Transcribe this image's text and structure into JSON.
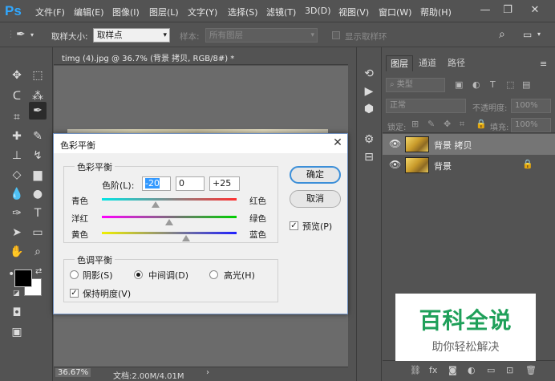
{
  "app": {
    "logo": "Ps",
    "menu": [
      "文件(F)",
      "编辑(E)",
      "图像(I)",
      "图层(L)",
      "文字(Y)",
      "选择(S)",
      "滤镜(T)",
      "3D(D)",
      "视图(V)",
      "窗口(W)",
      "帮助(H)"
    ],
    "window_controls": [
      "minimize-icon",
      "restore-icon",
      "close-icon"
    ]
  },
  "options": {
    "sample_size_label": "取样大小:",
    "sample_size_value": "取样点",
    "sample_label": "样本:",
    "sample_value": "所有图层",
    "show_ring_label": "显示取样环"
  },
  "document": {
    "tab_title": "timg (4).jpg @ 36.7% (背景 拷贝, RGB/8#) *",
    "zoom": "36.67%",
    "doc_info": "文档:2.00M/4.01M"
  },
  "layers_panel": {
    "tabs": [
      "图层",
      "通道",
      "路径"
    ],
    "filter_kind": "类型",
    "blend_mode": "正常",
    "opacity_label": "不透明度:",
    "opacity_value": "100%",
    "lock_label": "锁定:",
    "fill_label": "填充:",
    "fill_value": "100%",
    "layers": [
      {
        "name": "背景 拷贝",
        "selected": true,
        "locked": false
      },
      {
        "name": "背景",
        "selected": false,
        "locked": true
      }
    ]
  },
  "dialog": {
    "title": "色彩平衡",
    "color_balance_group": "色彩平衡",
    "levels_label": "色阶(L):",
    "levels": [
      "-20",
      "0",
      "+25"
    ],
    "sliders": [
      {
        "left": "青色",
        "right": "红色",
        "value": -20,
        "colors": [
          "#00e5e5",
          "#ff3030"
        ]
      },
      {
        "left": "洋红",
        "right": "绿色",
        "value": 0,
        "colors": [
          "#ff00ff",
          "#00d000"
        ]
      },
      {
        "left": "黄色",
        "right": "蓝色",
        "value": 25,
        "colors": [
          "#f0f000",
          "#2020ff"
        ]
      }
    ],
    "tone_group": "色调平衡",
    "tones": [
      "阴影(S)",
      "中间调(D)",
      "高光(H)"
    ],
    "tone_selected": 1,
    "preserve_luminosity": "保持明度(V)",
    "preserve_checked": true,
    "ok": "确定",
    "cancel": "取消",
    "preview": "预览(P)",
    "preview_checked": true
  },
  "watermark": {
    "title": "百科全说",
    "subtitle": "助你轻松解决",
    "color": "#1fa05a"
  },
  "colors": {
    "foreground": "#000000",
    "background": "#ffffff",
    "accent": "#31a8ff"
  }
}
